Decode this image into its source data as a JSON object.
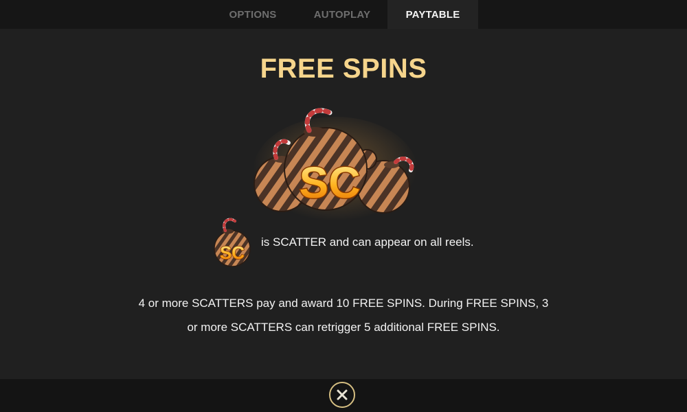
{
  "tabs": {
    "options": "OPTIONS",
    "autoplay": "AUTOPLAY",
    "paytable": "PAYTABLE",
    "active": "PAYTABLE"
  },
  "section": {
    "title": "FREE SPINS"
  },
  "symbol": {
    "label": "SC",
    "icon": "scatter-ornament-icon"
  },
  "scatter_info": "is SCATTER and can appear on all reels.",
  "description": {
    "line1": "4 or more SCATTERS pay and award 10 FREE SPINS. During FREE SPINS, 3",
    "line2": "or more SCATTERS can retrigger 5 additional FREE SPINS."
  },
  "close": {
    "icon": "close-icon"
  },
  "colors": {
    "title": "#f6d58c",
    "active_tab_bg": "#232323",
    "inactive_tab_text": "#6e6e6e",
    "close_ring": "#d6bf82"
  }
}
